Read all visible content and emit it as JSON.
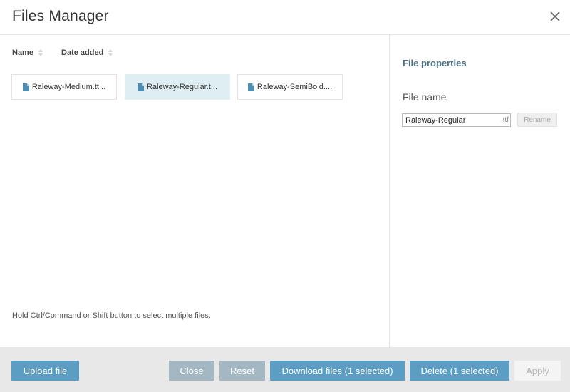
{
  "dialog": {
    "title": "Files Manager",
    "close_icon": "close-icon"
  },
  "sort": {
    "name_label": "Name",
    "date_label": "Date added"
  },
  "files": [
    {
      "label": "Raleway-Medium.tt...",
      "selected": false
    },
    {
      "label": "Raleway-Regular.t...",
      "selected": true
    },
    {
      "label": "Raleway-SemiBold....",
      "selected": false
    }
  ],
  "hint": "Hold Ctrl/Command or Shift button to select multiple files.",
  "properties": {
    "title": "File properties",
    "file_name_label": "File name",
    "file_name_value": "Raleway-Regular",
    "extension": ".ttf",
    "rename_label": "Rename"
  },
  "footer": {
    "upload_label": "Upload file",
    "close_label": "Close",
    "reset_label": "Reset",
    "download_label": "Download files (1 selected)",
    "delete_label": "Delete (1 selected)",
    "apply_label": "Apply"
  },
  "colors": {
    "accent": "#5b9dc3",
    "selected_tile": "#deeef3",
    "muted_button": "#a4b8c4",
    "heading": "#4a6f82"
  }
}
